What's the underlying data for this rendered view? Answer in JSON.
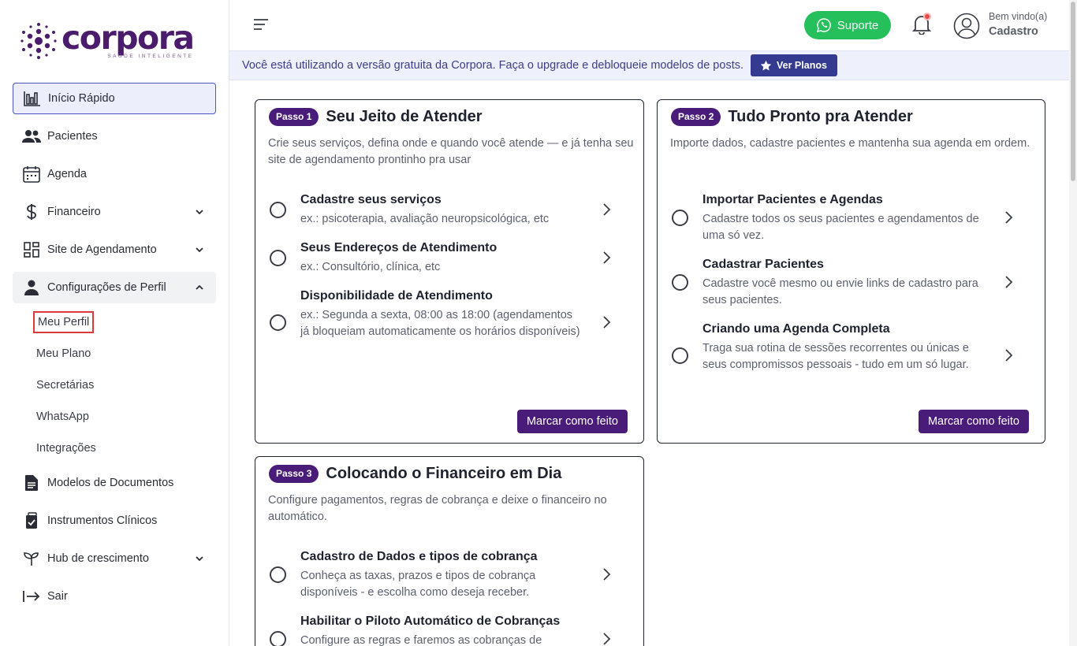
{
  "logo": {
    "word": "corpora",
    "tagline": "SAÚDE INTELIGENTE"
  },
  "sidebar": {
    "items": [
      {
        "label": "Início Rápido",
        "icon": "chart-bars-icon"
      },
      {
        "label": "Pacientes",
        "icon": "users-icon"
      },
      {
        "label": "Agenda",
        "icon": "calendar-icon"
      },
      {
        "label": "Financeiro",
        "icon": "dollar-icon"
      },
      {
        "label": "Site de Agendamento",
        "icon": "dashboard-icon"
      },
      {
        "label": "Configurações de Perfil",
        "icon": "person-icon"
      },
      {
        "label": "Modelos de Documentos",
        "icon": "document-icon"
      },
      {
        "label": "Instrumentos Clínicos",
        "icon": "clipboard-check-icon"
      },
      {
        "label": "Hub de crescimento",
        "icon": "sprout-icon"
      },
      {
        "label": "Sair",
        "icon": "logout-icon"
      }
    ],
    "profile_sub": [
      "Meu Perfil",
      "Meu Plano",
      "Secretárias",
      "WhatsApp",
      "Integrações"
    ]
  },
  "header": {
    "support_label": "Suporte",
    "welcome": "Bem vindo(a)",
    "user_name": "Cadastro"
  },
  "banner": {
    "text": "Você está utilizando a versão gratuita da Corpora. Faça o upgrade e debloqueie modelos de posts.",
    "button": "Ver Planos"
  },
  "cards": [
    {
      "badge": "Passo 1",
      "title": "Seu Jeito de Atender",
      "desc": "Crie seus serviços, defina onde e quando você atende — e já tenha seu site de agendamento prontinho pra usar",
      "tasks": [
        {
          "title": "Cadastre seus serviços",
          "desc": "ex.: psicoterapia, avaliação neuropsicológica, etc"
        },
        {
          "title": "Seus Endereços de Atendimento",
          "desc": "ex.: Consultório, clínica, etc"
        },
        {
          "title": "Disponibilidade de Atendimento",
          "desc": "ex.: Segunda a sexta, 08:00 as 18:00 (agendamentos já bloqueiam automaticamente os horários disponíveis)"
        }
      ],
      "button": "Marcar como feito"
    },
    {
      "badge": "Passo 2",
      "title": "Tudo Pronto pra Atender",
      "desc": "Importe dados, cadastre pacientes e mantenha sua agenda em ordem.",
      "tasks": [
        {
          "title": "Importar Pacientes e Agendas",
          "desc": "Cadastre todos os seus pacientes e agendamentos de uma só vez."
        },
        {
          "title": "Cadastrar Pacientes",
          "desc": "Cadastre você mesmo ou envie links de cadastro para seus pacientes."
        },
        {
          "title": "Criando uma Agenda Completa",
          "desc": "Traga sua rotina de sessões recorrentes ou únicas e seus compromissos pessoais - tudo em um só lugar."
        }
      ],
      "button": "Marcar como feito"
    },
    {
      "badge": "Passo 3",
      "title": "Colocando o Financeiro em Dia",
      "desc": "Configure pagamentos, regras de cobrança e deixe o financeiro no automático.",
      "tasks": [
        {
          "title": "Cadastro de Dados e tipos de cobrança",
          "desc": "Conheça as taxas, prazos e tipos de cobrança disponíveis - e escolha como deseja receber."
        },
        {
          "title": "Habilitar o Piloto Automático de Cobranças",
          "desc": "Configure as regras e faremos as cobranças de"
        }
      ]
    }
  ],
  "colors": {
    "brand": "#4a1c7a",
    "support": "#25c05c",
    "banner_bg": "#eef0fb",
    "banner_btn": "#333a8f",
    "active_border": "#4a56c9"
  }
}
